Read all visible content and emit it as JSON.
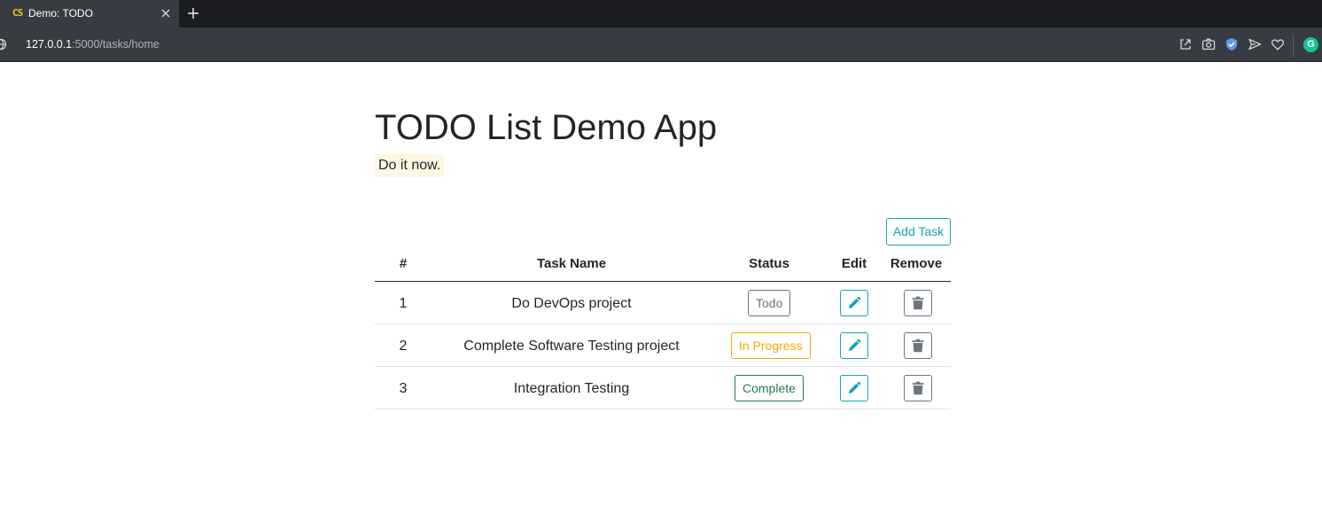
{
  "browser": {
    "tab": {
      "title": "Demo: TODO",
      "favicon_text": "CS"
    },
    "address_bar": {
      "host": "127.0.0.1",
      "path": ":5000/tasks/home"
    },
    "toolbar_icons": [
      "share-icon",
      "camera-icon",
      "shield-icon",
      "send-icon",
      "heart-icon",
      "grammarly-icon"
    ],
    "grammarly_letter": "G"
  },
  "page": {
    "title": "TODO List Demo App",
    "subtitle": "Do it now.",
    "add_task_label": "Add Task"
  },
  "table": {
    "headers": {
      "num": "#",
      "name": "Task Name",
      "status": "Status",
      "edit": "Edit",
      "remove": "Remove"
    },
    "rows": [
      {
        "num": "1",
        "name": "Do DevOps project",
        "status": "Todo",
        "status_color": "#6c757d"
      },
      {
        "num": "2",
        "name": "Complete Software Testing project",
        "status": "In Progress",
        "status_color": "#f0ad00"
      },
      {
        "num": "3",
        "name": "Integration Testing",
        "status": "Complete",
        "status_color": "#1e7e4f"
      }
    ]
  },
  "colors": {
    "accent": "#17a2b8",
    "secondary": "#6c757d",
    "highlight": "#fcf8e3"
  }
}
